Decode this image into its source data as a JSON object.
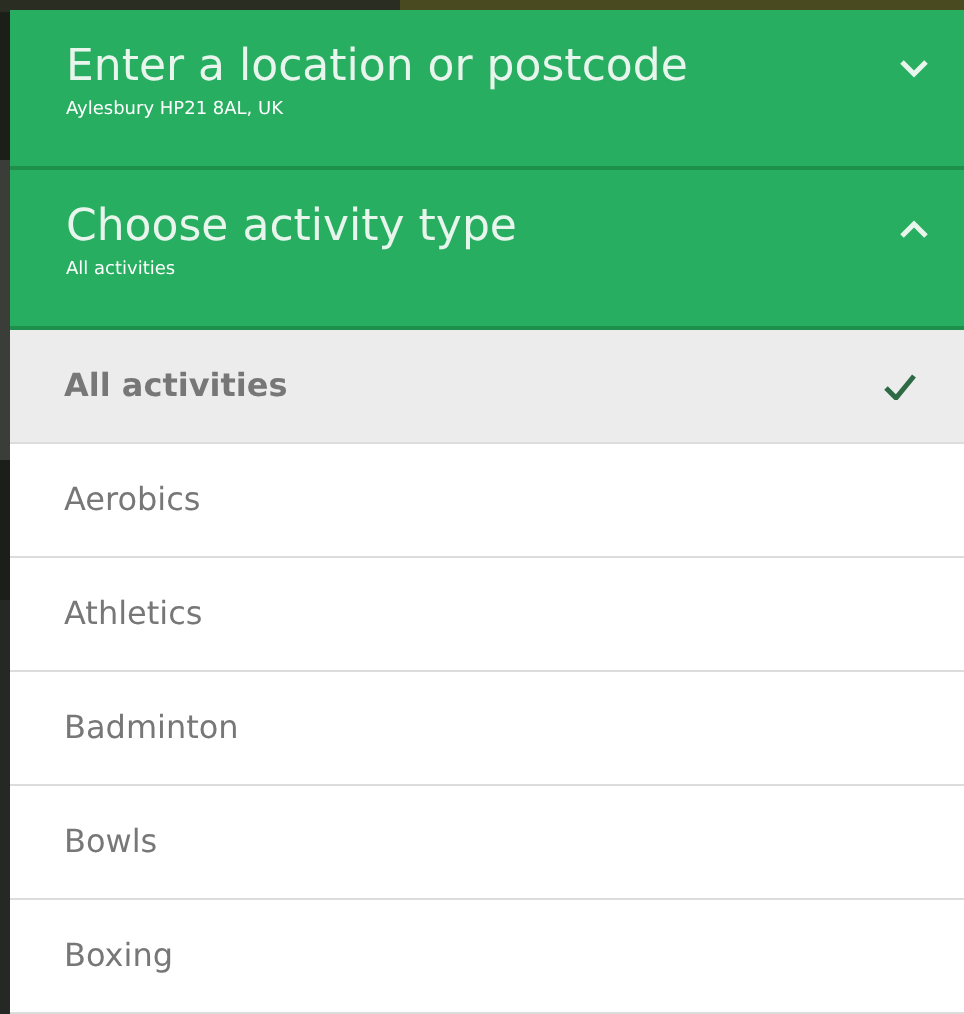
{
  "sections": [
    {
      "title": "Enter a location or postcode",
      "value": "Aylesbury HP21 8AL, UK",
      "expanded": false
    },
    {
      "title": "Choose activity type",
      "value": "All activities",
      "expanded": true
    }
  ],
  "activities": [
    {
      "label": "All activities",
      "selected": true
    },
    {
      "label": "Aerobics",
      "selected": false
    },
    {
      "label": "Athletics",
      "selected": false
    },
    {
      "label": "Badminton",
      "selected": false
    },
    {
      "label": "Bowls",
      "selected": false
    },
    {
      "label": "Boxing",
      "selected": false
    }
  ]
}
